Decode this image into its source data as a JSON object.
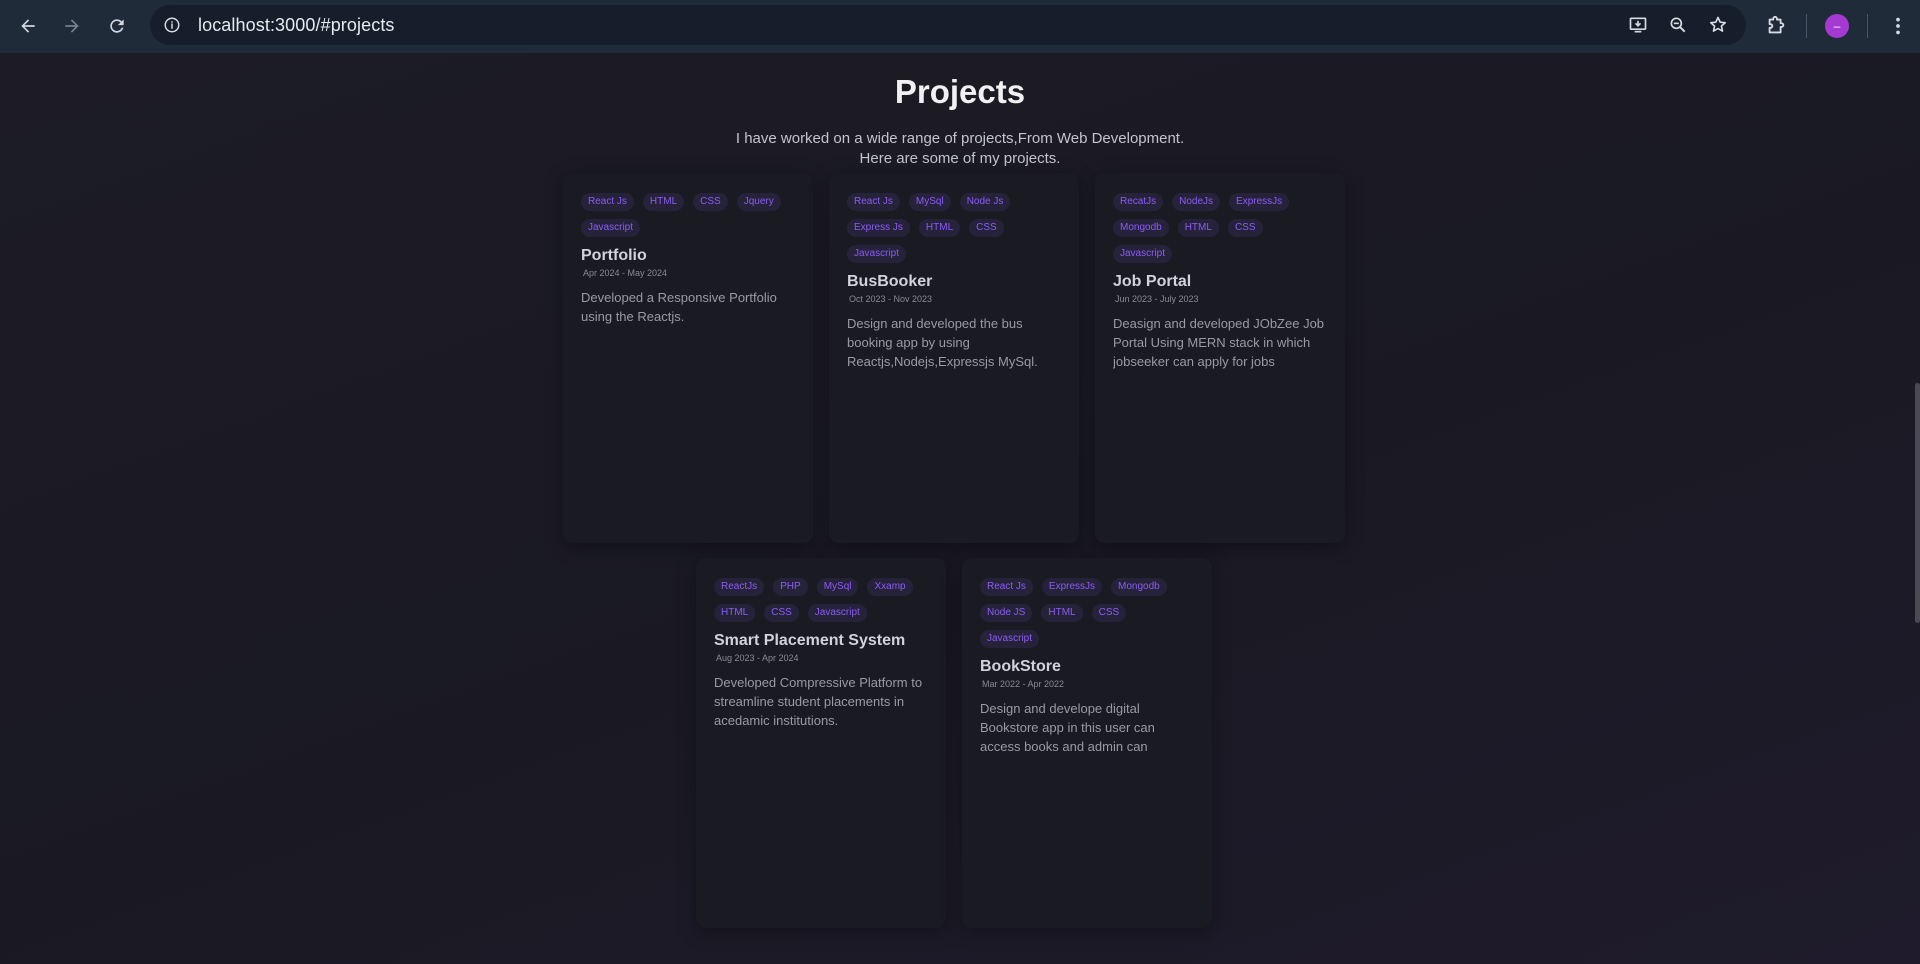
{
  "browser": {
    "url": "localhost:3000/#projects",
    "avatar_initial": "–"
  },
  "section": {
    "title": "Projects",
    "description_line1": "I have worked on a wide range of projects,From Web Development.",
    "description_line2": "Here are some of my projects."
  },
  "projects": [
    {
      "title": "Portfolio",
      "date": "Apr 2024 - May 2024",
      "description": "Developed a Responsive Portfolio using the Reactjs.",
      "tags": [
        "React Js",
        "HTML",
        "CSS",
        "Jquery",
        "Javascript"
      ]
    },
    {
      "title": "BusBooker",
      "date": "Oct 2023 - Nov 2023",
      "description": "Design and developed the bus booking app by using Reactjs,Nodejs,Expressjs MySql.",
      "tags": [
        "React Js",
        "MySql",
        "Node Js",
        "Express Js",
        "HTML",
        "CSS",
        "Javascript"
      ]
    },
    {
      "title": "Job Portal",
      "date": "Jun 2023 - July 2023",
      "description": "Deasign and developed JObZee Job Portal Using MERN stack in which jobseeker can apply for jobs",
      "tags": [
        "RecatJs",
        "NodeJs",
        "ExpressJs",
        "Mongodb",
        "HTML",
        "CSS",
        "Javascript"
      ]
    },
    {
      "title": "Smart Placement System",
      "date": "Aug 2023 - Apr 2024",
      "description": "Developed Compressive Platform to streamline student placements in acedamic institutions.",
      "tags": [
        "ReactJs",
        "PHP",
        "MySql",
        "Xxamp",
        "HTML",
        "CSS",
        "Javascript"
      ]
    },
    {
      "title": "BookStore",
      "date": "Mar 2022 - Apr 2022",
      "description": "Design and develope digital Bookstore app in this user can access books and admin can",
      "tags": [
        "React Js",
        "ExpressJs",
        "Mongodb",
        "Node JS",
        "HTML",
        "CSS",
        "Javascript"
      ]
    }
  ]
}
